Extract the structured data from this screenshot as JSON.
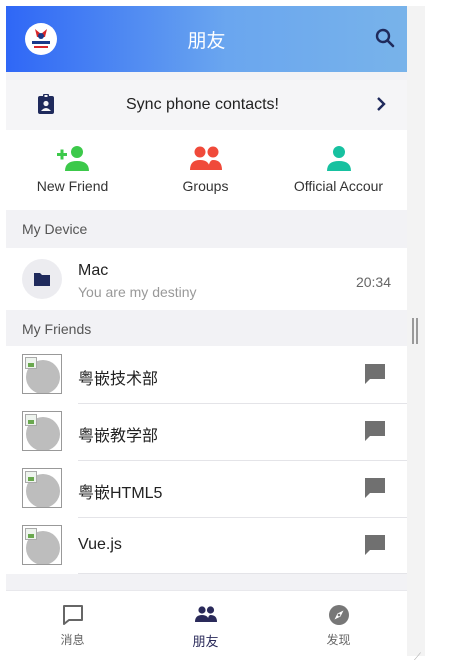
{
  "header": {
    "title": "朋友",
    "logo_icon": "logo-icon",
    "search_icon": "search-icon",
    "gradient_start": "#2f67f6",
    "gradient_end": "#78b3ea"
  },
  "sync": {
    "label": "Sync phone contacts!",
    "icon": "contacts-badge-icon",
    "chevron_icon": "chevron-right-icon"
  },
  "quick_actions": [
    {
      "label": "New Friend",
      "icon": "add-person-icon",
      "color": "#3cc94a"
    },
    {
      "label": "Groups",
      "icon": "group-icon",
      "color": "#f04a3a"
    },
    {
      "label": "Official Accour",
      "icon": "person-icon",
      "color": "#17c1a0"
    }
  ],
  "sections": {
    "device": "My Device",
    "friends": "My Friends"
  },
  "device": {
    "name": "Mac",
    "subtitle": "You are my destiny",
    "time": "20:34",
    "icon": "folder-icon"
  },
  "friends": [
    {
      "name": "粤嵌技术部"
    },
    {
      "name": "粤嵌教学部"
    },
    {
      "name": "粤嵌HTML5"
    },
    {
      "name": "Vue.js"
    }
  ],
  "bottom_nav": [
    {
      "label": "消息",
      "icon": "chat-outline-icon",
      "active": false
    },
    {
      "label": "朋友",
      "icon": "people-icon",
      "active": true
    },
    {
      "label": "发现",
      "icon": "compass-icon",
      "active": false
    }
  ],
  "colors": {
    "accent": "#2a2a5a",
    "chat_icon": "#707070",
    "background": "#f2f2f5"
  }
}
